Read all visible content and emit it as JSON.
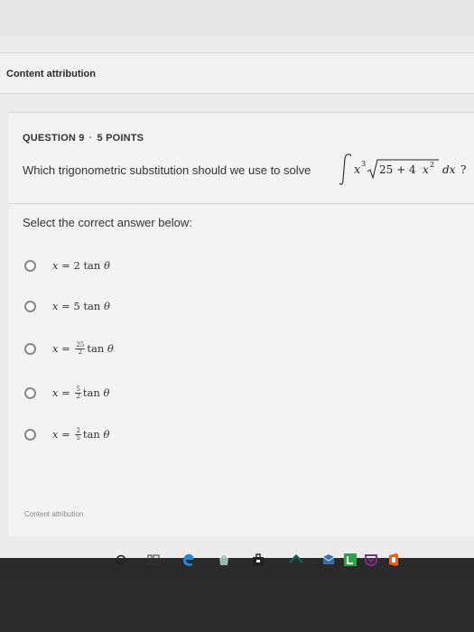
{
  "header": {
    "attribution": "Content attribution"
  },
  "question": {
    "number_label": "QUESTION 9",
    "separator": "·",
    "points_label": "5 POINTS",
    "prompt": "Which trigonometric substitution should we use to solve"
  },
  "instruction": "Select the correct answer below:",
  "options": [
    {
      "lhs": "x",
      "eq": "=",
      "coef": "2",
      "trig": "tan",
      "var": "θ"
    },
    {
      "lhs": "x",
      "eq": "=",
      "coef": "5",
      "trig": "tan",
      "var": "θ"
    },
    {
      "lhs": "x",
      "eq": "=",
      "num": "25",
      "den": "2",
      "trig": "tan",
      "var": "θ"
    },
    {
      "lhs": "x",
      "eq": "=",
      "num": "5",
      "den": "2",
      "trig": "tan",
      "var": "θ"
    },
    {
      "lhs": "x",
      "eq": "=",
      "num": "2",
      "den": "5",
      "trig": "tan",
      "var": "θ"
    }
  ],
  "footer": {
    "attribution": "Content attribution"
  },
  "taskbar": {
    "icons": [
      "search-circle-icon",
      "task-view-icon",
      "edge-browser-icon",
      "store-bag-icon",
      "chevron-icon",
      "blue-square-icon",
      "shield-icon",
      "pocket-icon",
      "office-icon"
    ],
    "colors": {
      "edge": "#1f8ad6",
      "green": "#2fa24a",
      "orange": "#e8601c",
      "purple": "#7a2f8a"
    }
  }
}
